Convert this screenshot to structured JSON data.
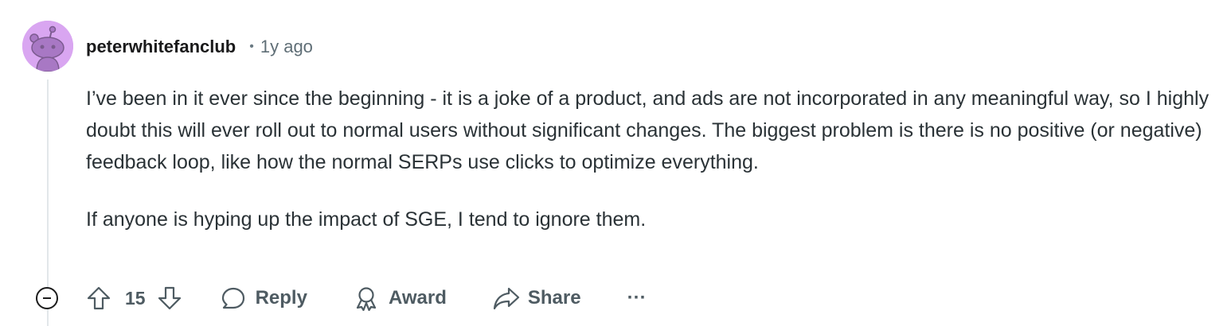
{
  "comment": {
    "author": "peterwhitefanclub",
    "separator": "•",
    "time_ago": "1y ago",
    "paragraphs": [
      "I’ve been in it ever since the beginning - it is a joke of a product, and ads are not incorporated in any meaningful way, so I highly doubt this will ever roll out to normal users without significant changes. The biggest problem is there is no positive (or negative) feedback loop, like how the normal SERPs use clicks to optimize everything.",
      "If anyone is hyping up the impact of SGE, I tend to ignore them."
    ]
  },
  "actions": {
    "score": "15",
    "reply_label": "Reply",
    "award_label": "Award",
    "share_label": "Share",
    "more_label": "···"
  },
  "icons": {
    "avatar": "reddit-snoo-avatar",
    "collapse": "minus-circle-icon",
    "upvote": "arrow-up-icon",
    "downvote": "arrow-down-icon",
    "reply": "speech-bubble-icon",
    "award": "award-ribbon-icon",
    "share": "share-arrow-icon",
    "more": "ellipsis-icon"
  },
  "colors": {
    "avatar_bg": "#d9a6f1",
    "text": "#2a3236",
    "muted": "#5f6e76"
  }
}
